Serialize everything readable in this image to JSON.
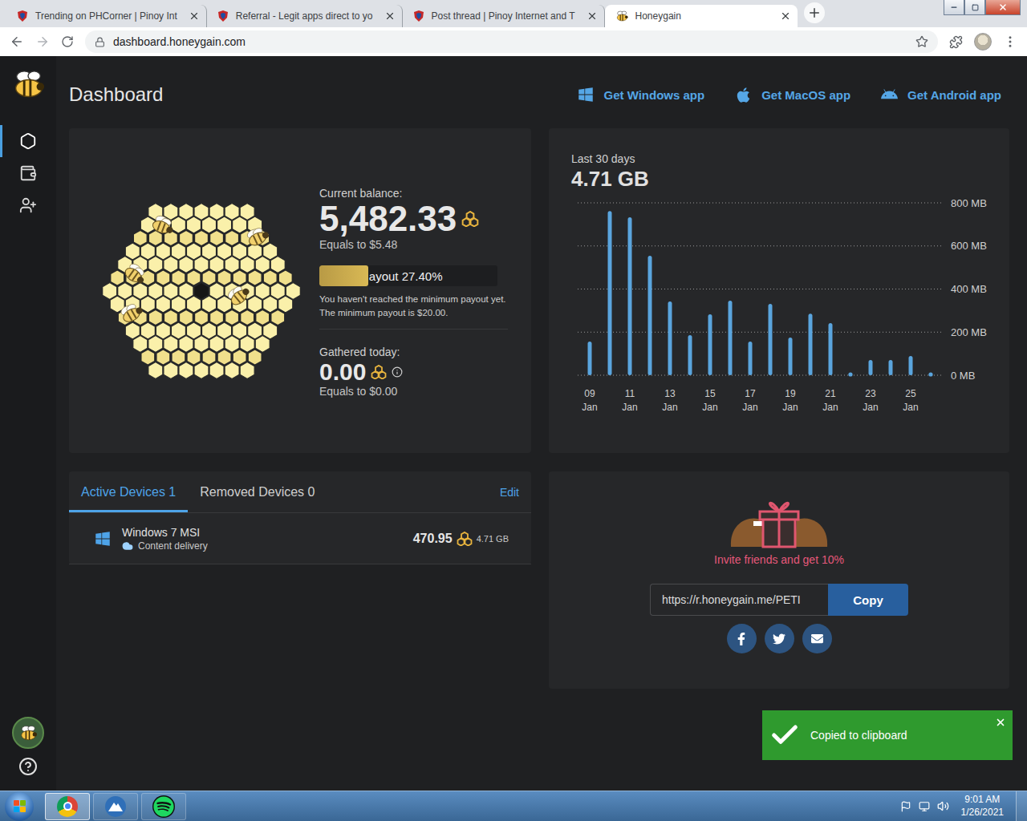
{
  "browser": {
    "tabs": [
      {
        "label": "Trending on PHCorner | Pinoy Int",
        "kind": "phcorner",
        "selected": false
      },
      {
        "label": "Referral - Legit apps direct to yo",
        "kind": "phcorner",
        "selected": false
      },
      {
        "label": "Post thread | Pinoy Internet and T",
        "kind": "phcorner",
        "selected": false
      },
      {
        "label": "Honeygain",
        "kind": "honeygain",
        "selected": true
      }
    ],
    "address": "dashboard.honeygain.com"
  },
  "sidebar": {
    "items": [
      {
        "kind": "dashboard",
        "selected": true
      },
      {
        "kind": "wallet",
        "selected": false
      },
      {
        "kind": "referrals",
        "selected": false
      }
    ]
  },
  "page": {
    "title": "Dashboard",
    "app_links": [
      {
        "kind": "windows",
        "label": "Get Windows app"
      },
      {
        "kind": "macos",
        "label": "Get MacOS app"
      },
      {
        "kind": "android",
        "label": "Get Android app"
      }
    ]
  },
  "balance": {
    "label": "Current balance:",
    "value": "5,482.33",
    "equals": "Equals to $5.48"
  },
  "payout": {
    "label": "ayout 27.40%",
    "level": 0.274,
    "note": "You haven't reached the minimum payout yet. The minimum payout is $20.00."
  },
  "today": {
    "label": "Gathered today:",
    "value": "0.00",
    "equals": "Equals to $0.00"
  },
  "chart": {
    "period": "Last 30 days",
    "total": "4.71 GB",
    "y_max": 800,
    "y_ticks": [
      "800 MB",
      "600 MB",
      "400 MB",
      "200 MB",
      "0 MB"
    ],
    "x_ticks": [
      {
        "day": "09",
        "month": "Jan"
      },
      {
        "day": "11",
        "month": "Jan"
      },
      {
        "day": "13",
        "month": "Jan"
      },
      {
        "day": "15",
        "month": "Jan"
      },
      {
        "day": "17",
        "month": "Jan"
      },
      {
        "day": "19",
        "month": "Jan"
      },
      {
        "day": "21",
        "month": "Jan"
      },
      {
        "day": "23",
        "month": "Jan"
      },
      {
        "day": "25",
        "month": "Jan"
      }
    ],
    "series": [
      {
        "name": "traffic",
        "unit": "MB",
        "values": [
          156,
          762,
          733,
          554,
          342,
          186,
          283,
          346,
          156,
          331,
          175,
          286,
          242,
          3,
          71,
          71,
          89,
          3
        ]
      }
    ]
  },
  "devices": {
    "tabs": [
      {
        "label": "Active Devices 1",
        "selected": true
      },
      {
        "label": "Removed Devices 0",
        "selected": false
      }
    ],
    "edit": "Edit",
    "rows": [
      {
        "name": "Windows 7 MSI",
        "service": "Content delivery",
        "credits": "470.95",
        "traffic": "4.71 GB"
      }
    ]
  },
  "referral": {
    "title": "Invite friends and get 10%",
    "link": "https://r.honeygain.me/PETI",
    "copy": "Copy"
  },
  "toast": {
    "message": "Copied to clipboard"
  },
  "taskbar": {
    "apps": [
      {
        "kind": "chrome",
        "selected": true
      },
      {
        "kind": "app",
        "selected": false
      },
      {
        "kind": "spotify",
        "selected": false
      }
    ],
    "time": "9:01 AM",
    "date": "1/26/2021"
  }
}
